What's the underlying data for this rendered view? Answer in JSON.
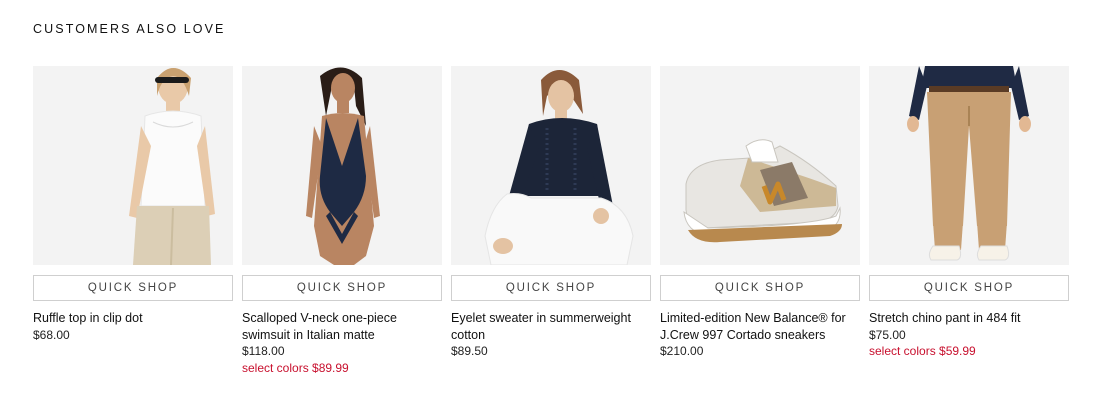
{
  "section": {
    "title": "CUSTOMERS ALSO LOVE"
  },
  "quick_shop_label": "QUICK SHOP",
  "colors": {
    "sale": "#c8102e",
    "image_bg": "#f3f3f3",
    "border": "#cfcfcf"
  },
  "products": [
    {
      "name": "Ruffle top in clip dot",
      "price": "$68.00",
      "sale": "",
      "image": "woman-ruffle-top-photo"
    },
    {
      "name": "Scalloped V-neck one-piece swimsuit in Italian matte",
      "price": "$118.00",
      "sale": "select colors $89.99",
      "image": "navy-swimsuit-photo"
    },
    {
      "name": "Eyelet sweater in summerweight cotton",
      "price": "$89.50",
      "sale": "",
      "image": "navy-sweater-photo"
    },
    {
      "name": "Limited-edition New Balance® for J.Crew 997 Cortado sneakers",
      "price": "$210.00",
      "sale": "",
      "image": "sneaker-photo"
    },
    {
      "name": "Stretch chino pant in 484 fit",
      "price": "$75.00",
      "sale": "select colors $59.99",
      "image": "khaki-chino-photo"
    }
  ]
}
